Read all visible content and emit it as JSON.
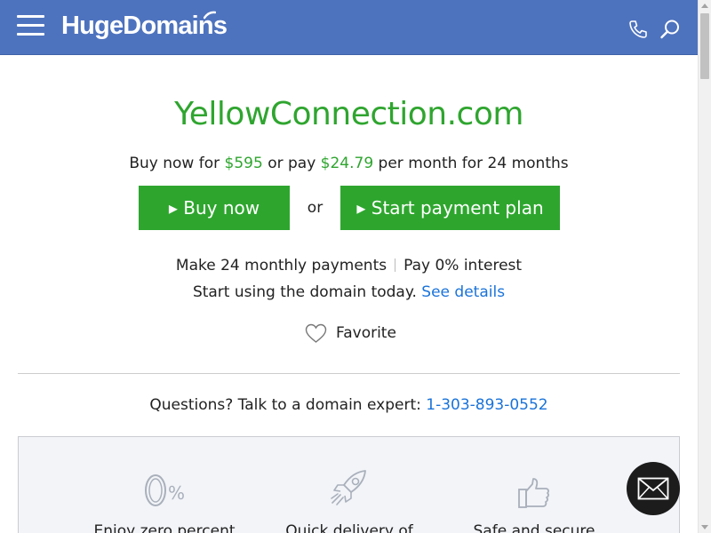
{
  "header": {
    "logo_text": "HugeDomains",
    "menu_icon": "hamburger-menu-icon",
    "phone_icon": "phone-icon",
    "search_icon": "search-icon",
    "background_color": "#4e73be"
  },
  "domain": {
    "name": "YellowConnection.com"
  },
  "pricing": {
    "prefix": "Buy now for ",
    "price": "$595",
    "middle": " or pay ",
    "monthly": "$24.79",
    "suffix": " per month for 24 months"
  },
  "actions": {
    "buy_now_label": "▸ Buy now",
    "or_label": "or",
    "payment_plan_label": "▸ Start payment plan"
  },
  "info": {
    "monthly_payments": "Make 24 monthly payments",
    "interest": "Pay 0% interest",
    "start_using": "Start using the domain today.",
    "see_details": "See details"
  },
  "favorite": {
    "label": "Favorite",
    "icon": "heart-icon"
  },
  "contact": {
    "questions": "Questions? Talk to a domain expert:",
    "phone": "1-303-893-0552"
  },
  "features": [
    {
      "icon": "zero-percent-icon",
      "label": "Enjoy zero percent"
    },
    {
      "icon": "rocket-icon",
      "label": "Quick delivery of"
    },
    {
      "icon": "thumbs-up-icon",
      "label": "Safe and secure"
    }
  ],
  "chat": {
    "icon": "envelope-icon"
  },
  "colors": {
    "accent_green": "#2ea62e",
    "link_blue": "#1a73d9",
    "header_blue": "#4e73be"
  }
}
